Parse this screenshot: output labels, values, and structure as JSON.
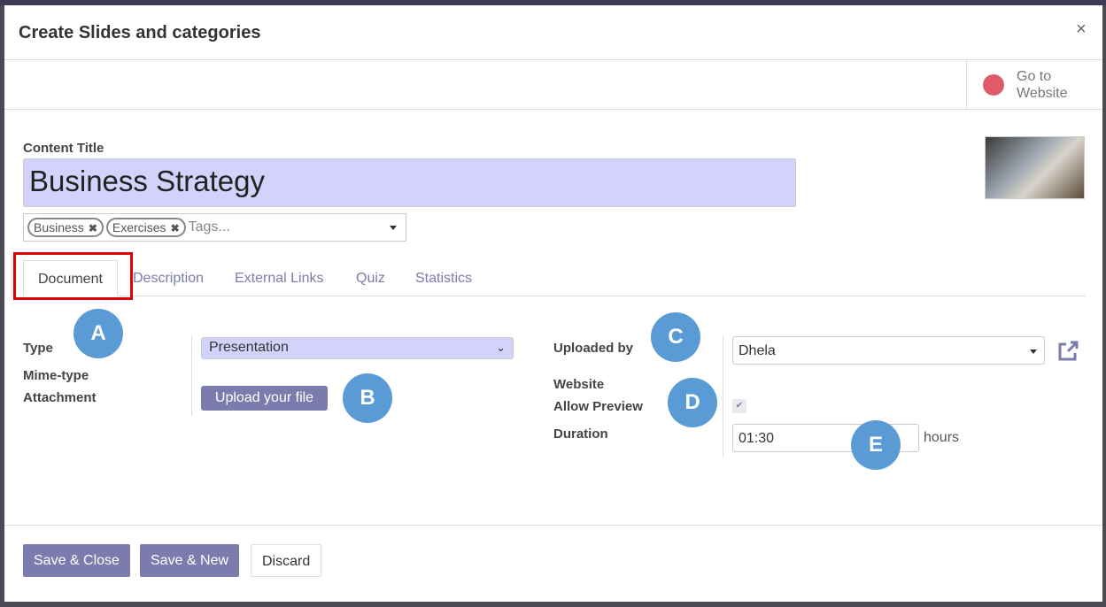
{
  "dialog": {
    "title": "Create Slides and categories",
    "close_label": "×"
  },
  "header": {
    "go_to_website": "Go to Website",
    "go_to_website_line1": "Go to",
    "go_to_website_line2": "Website"
  },
  "form": {
    "content_title_label": "Content Title",
    "content_title_value": "Business Strategy",
    "tags": [
      {
        "label": "Business"
      },
      {
        "label": "Exercises"
      }
    ],
    "tags_placeholder": "Tags...",
    "tag_remove": "✖"
  },
  "tabs": [
    {
      "label": "Document",
      "active": true
    },
    {
      "label": "Description"
    },
    {
      "label": "External Links"
    },
    {
      "label": "Quiz"
    },
    {
      "label": "Statistics"
    }
  ],
  "document": {
    "type_label": "Type",
    "type_value": "Presentation",
    "mimetype_label": "Mime-type",
    "attachment_label": "Attachment",
    "upload_label": "Upload your file",
    "uploaded_by_label": "Uploaded by",
    "uploaded_by_value": "Dhela",
    "website_label": "Website",
    "allow_preview_label": "Allow Preview",
    "allow_preview_checked": true,
    "duration_label": "Duration",
    "duration_value": "01:30",
    "duration_unit": "hours"
  },
  "annotations": [
    "A",
    "B",
    "C",
    "D",
    "E"
  ],
  "footer": {
    "save_close": "Save & Close",
    "save_new": "Save & New",
    "discard": "Discard"
  },
  "colors": {
    "primary": "#7c7bad",
    "highlight_input": "#d2d2fb",
    "annotation": "#5b9bd5",
    "highlight_box": "#e30000"
  }
}
